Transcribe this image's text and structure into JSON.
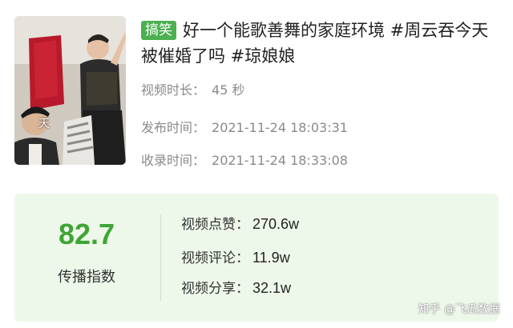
{
  "video": {
    "thumbnail": {
      "icon": "video-thumbnail-image",
      "overlay_text": "天"
    },
    "tag": "搞笑",
    "title": "好一个能歌善舞的家庭环境 #周云吞今天被催婚了吗 #琼娘娘",
    "duration": {
      "label": "视频时长：",
      "value": "45 秒"
    },
    "publish_time": {
      "label": "发布时间：",
      "value": "2021-11-24 18:03:31"
    },
    "record_time": {
      "label": "收录时间：",
      "value": "2021-11-24 18:33:08"
    }
  },
  "stats": {
    "score": "82.7",
    "score_label": "传播指数",
    "likes": {
      "label": "视频点赞：",
      "value": "270.6w"
    },
    "comments": {
      "label": "视频评论：",
      "value": "11.9w"
    },
    "shares": {
      "label": "视频分享：",
      "value": "32.1w"
    }
  },
  "watermark": "知乎 @飞瓜数据",
  "colors": {
    "tag_bg": "#4caf50",
    "score": "#3fa535",
    "stats_bg": "#eef8ea",
    "meta_text": "#8a8a8a"
  }
}
